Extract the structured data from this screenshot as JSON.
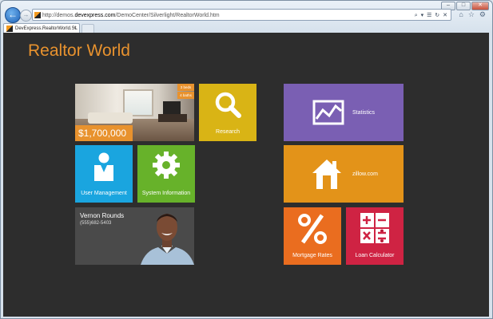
{
  "browser": {
    "address_prefix": "http://demos.",
    "address_host": "devexpress.com",
    "address_path": "/DemoCenter/Silverlight/RealtorWorld.htm",
    "address_tools": "⌕ ▾ ☰ ↻ ✕",
    "tab_title": "DevExpress.RealtorWorld.SL",
    "tab_close": "×",
    "back_glyph": "←",
    "forward_glyph": "→",
    "caption": {
      "minimize": "–",
      "maximize": "□",
      "close": "✕"
    },
    "toolbar_icons": {
      "home": "⌂",
      "favorites": "☆",
      "tools": "⚙"
    }
  },
  "app": {
    "title": "Realtor World",
    "house": {
      "beds": "3 beds",
      "baths": "4 baths",
      "price": "$1,700,000"
    },
    "contact": {
      "name": "Vernon Rounds",
      "phone": "(555)682-5403"
    },
    "tiles": {
      "research": "Research",
      "statistics": "Statistics",
      "user_management": "User Management",
      "system_information": "System Information",
      "zillow": "zillow.com",
      "mortgage": "Mortgage Rates",
      "loan": "Loan Calculator"
    }
  },
  "colors": {
    "accent": "#e8922e",
    "research": "#d9b415",
    "statistics": "#7a5fb3",
    "user": "#1aa5df",
    "system": "#67b22a",
    "zillow": "#e39319",
    "mortgage": "#ea6d1f",
    "loan": "#cf2343",
    "background": "#2d2d2d"
  }
}
